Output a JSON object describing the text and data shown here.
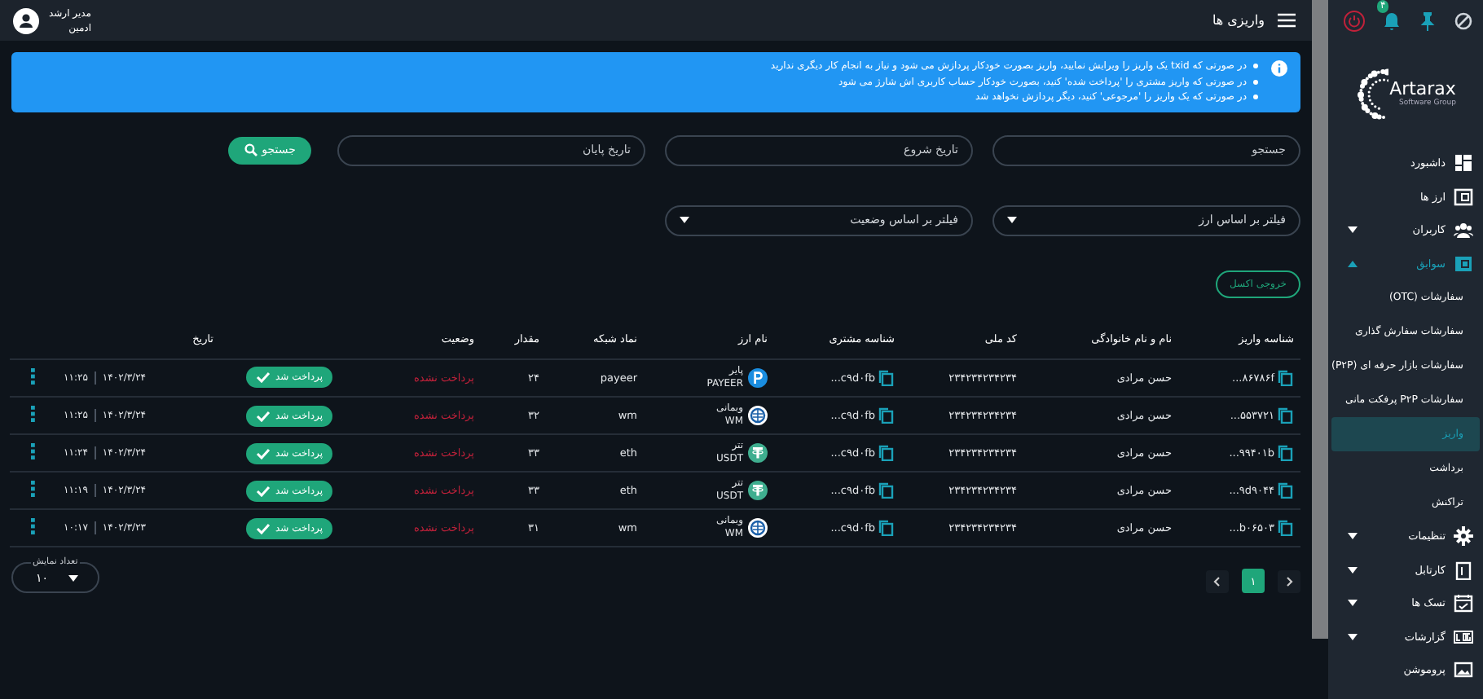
{
  "topbar": {
    "title": "واریزی ها",
    "user": {
      "name": "مدیر ارشد",
      "role": "ادمین"
    },
    "notification_count": "۴"
  },
  "logo": {
    "name": "Artarax",
    "tagline": "Software Group"
  },
  "sidebar": {
    "items": [
      {
        "label": "داشبورد",
        "selected": false
      },
      {
        "label": "ارز ها",
        "selected": false
      },
      {
        "label": "کاربران",
        "selected": false,
        "expanded": false
      },
      {
        "label": "سوابق",
        "selected": true,
        "expanded": true,
        "children": [
          {
            "label": "سفارشات (OTC)",
            "selected": false
          },
          {
            "label": "سفارشات سفارش گذاری",
            "selected": false
          },
          {
            "label": "سفارشات بازار حرفه ای (P۲P)",
            "selected": false
          },
          {
            "label": "سفارشات P۲P پرفکت مانی",
            "selected": false
          },
          {
            "label": "واریز",
            "selected": true
          },
          {
            "label": "برداشت",
            "selected": false
          },
          {
            "label": "تراکنش",
            "selected": false
          }
        ]
      },
      {
        "label": "تنظیمات",
        "selected": false,
        "expanded": false
      },
      {
        "label": "کارتابل",
        "selected": false,
        "expanded": false
      },
      {
        "label": "تسک ها",
        "selected": false,
        "expanded": false
      },
      {
        "label": "گزارشات",
        "selected": false,
        "expanded": false
      },
      {
        "label": "پروموشن",
        "selected": false
      }
    ]
  },
  "alert": {
    "items": [
      "در صورتی که txid یک واریز را ویرایش نمایید، واریز بصورت خودکار پردازش می شود و نیاز به انجام کار دیگری ندارید",
      "در صورتی که واریز مشتری را 'پرداخت شده' کنید، بصورت خودکار حساب کاربری اش شارژ می شود",
      "در صورتی که یک واریز را 'مرجوعی' کنید، دیگر پردازش نخواهد شد"
    ]
  },
  "filters": {
    "search_placeholder": "جستجو",
    "start_date_placeholder": "تاریخ شروع",
    "end_date_placeholder": "تاریخ پایان",
    "search_button": "جستجو",
    "currency_filter": "فیلتر بر اساس ارز",
    "status_filter": "فیلتر بر اساس وضعیت",
    "export_button": "خروجی اکسل"
  },
  "table": {
    "columns": [
      "شناسه واریز",
      "نام و نام خانوادگی",
      "کد ملی",
      "شناسه مشتری",
      "نام ارز",
      "نماد شبکه",
      "مقدار",
      "وضعیت",
      "تاریخ"
    ],
    "rows": [
      {
        "deposit_id": "۸۶۷۸۶f...",
        "name": "حسن مرادی",
        "national_code": "۲۳۴۲۳۴۲۳۴۲۳۴",
        "customer_id": "c۹d۰fb...",
        "coin": {
          "kind": "payeer",
          "name": "پایر",
          "symbol": "PAYEER"
        },
        "network": "payeer",
        "amount": "۲۴",
        "status": "پرداخت نشده",
        "paid": false,
        "action": "پرداخت شد",
        "time": "۱۱:۲۵",
        "date": "۱۴۰۲/۳/۲۴"
      },
      {
        "deposit_id": "۵۵۳۷۲۱...",
        "name": "حسن مرادی",
        "national_code": "۲۳۴۲۳۴۲۳۴۲۳۴",
        "customer_id": "c۹d۰fb...",
        "coin": {
          "kind": "webmoney",
          "name": "وبمانی",
          "symbol": "WM"
        },
        "network": "wm",
        "amount": "۳۲",
        "status": "پرداخت نشده",
        "paid": false,
        "action": "پرداخت شد",
        "time": "۱۱:۲۵",
        "date": "۱۴۰۲/۳/۲۴"
      },
      {
        "deposit_id": "۹۹۴۰۱b...",
        "name": "حسن مرادی",
        "national_code": "۲۳۴۲۳۴۲۳۴۲۳۴",
        "customer_id": "c۹d۰fb...",
        "coin": {
          "kind": "tether",
          "name": "تتر",
          "symbol": "USDT"
        },
        "network": "eth",
        "amount": "۳۳",
        "status": "پرداخت نشده",
        "paid": false,
        "action": "پرداخت شد",
        "time": "۱۱:۲۴",
        "date": "۱۴۰۲/۳/۲۴"
      },
      {
        "deposit_id": "۹d۹۰۴۴...",
        "name": "حسن مرادی",
        "national_code": "۲۳۴۲۳۴۲۳۴۲۳۴",
        "customer_id": "c۹d۰fb...",
        "coin": {
          "kind": "tether",
          "name": "تتر",
          "symbol": "USDT"
        },
        "network": "eth",
        "amount": "۳۳",
        "status": "پرداخت نشده",
        "paid": false,
        "action": "پرداخت شد",
        "time": "۱۱:۱۹",
        "date": "۱۴۰۲/۳/۲۴"
      },
      {
        "deposit_id": "b۰۶۵۰۳...",
        "name": "حسن مرادی",
        "national_code": "۲۳۴۲۳۴۲۳۴۲۳۴",
        "customer_id": "c۹d۰fb...",
        "coin": {
          "kind": "webmoney",
          "name": "وبمانی",
          "symbol": "WM"
        },
        "network": "wm",
        "amount": "۳۱",
        "status": "پرداخت نشده",
        "paid": false,
        "action": "پرداخت شد",
        "time": "۱۰:۱۷",
        "date": "۱۴۰۲/۳/۲۳"
      }
    ]
  },
  "page_size": {
    "label": "تعداد نمایش",
    "value": "۱۰"
  },
  "pagination": {
    "pages": [
      {
        "label": "۱",
        "selected": true
      }
    ]
  }
}
